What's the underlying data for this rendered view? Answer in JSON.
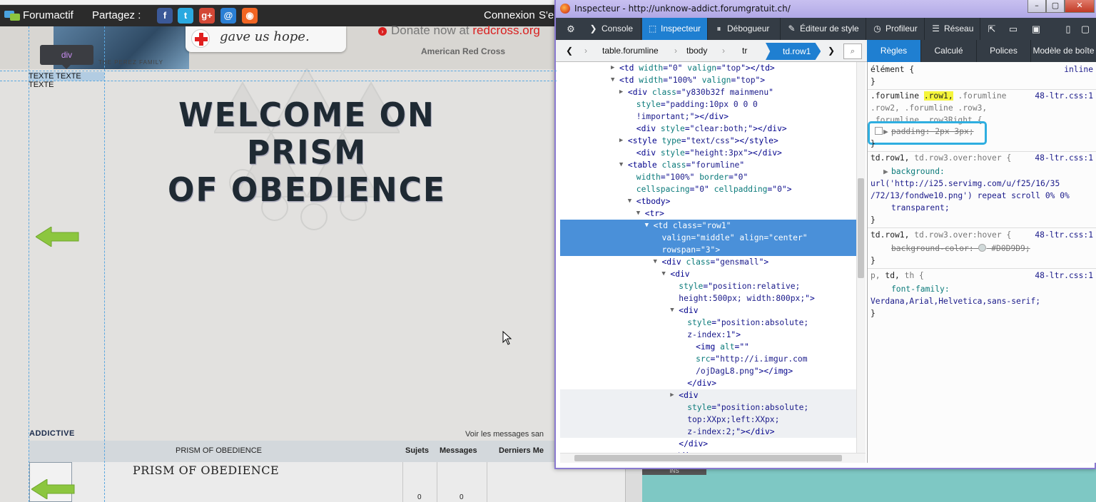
{
  "forum_bar": {
    "title": "Forumactif",
    "share_label": "Partagez :",
    "social": [
      {
        "name": "facebook-icon",
        "glyph": "f",
        "color": "#3b5998"
      },
      {
        "name": "twitter-icon",
        "glyph": "t",
        "color": "#2aa9e0"
      },
      {
        "name": "google-plus-icon",
        "glyph": "g+",
        "color": "#d34836"
      },
      {
        "name": "email-icon",
        "glyph": "@",
        "color": "#2a7fd4"
      },
      {
        "name": "rss-icon",
        "glyph": "◉",
        "color": "#f26522"
      }
    ],
    "connect": "Connexion",
    "signup_cut": "S'e"
  },
  "banner": {
    "hope_text": "gave us hope.",
    "donate_prefix": "Donate now at",
    "donate_link": "redcross.org",
    "org": "American Red Cross",
    "family": "THE PEREZ FAMILY"
  },
  "inspector_overlay": {
    "tooltip": "div",
    "highlighted_text": "TEXTE TEXTE TEXTE"
  },
  "forum": {
    "welcome_line1": "WELCOME ON PRISM",
    "welcome_line2": "OF OBEDIENCE",
    "category": "ADDICTIVE",
    "view_messages": "Voir les messages san",
    "col_forum": "PRISM OF OBEDIENCE",
    "col_topics": "Sujets",
    "col_messages": "Messages",
    "col_last": "Derniers Me",
    "row_title": "PRISM OF OBEDIENCE",
    "row_topics": "0",
    "row_messages": "0"
  },
  "inspector": {
    "window_title": "Inspecteur - http://unknow-addict.forumgratuit.ch/",
    "toolbar": {
      "console": "Console",
      "inspector": "Inspecteur",
      "debugger": "Débogueur",
      "style_editor": "Éditeur de style",
      "profiler": "Profileur",
      "network": "Réseau"
    },
    "breadcrumbs": [
      "table.forumline",
      "tbody",
      "tr"
    ],
    "breadcrumb_active": "td.row1",
    "side_tabs": [
      "Règles",
      "Calculé",
      "Polices",
      "Modèle de boîte"
    ],
    "markup": [
      {
        "indent": 11,
        "tw": "▶",
        "parts": [
          [
            "tg",
            "<td "
          ],
          [
            "at",
            "width"
          ],
          [
            "tg",
            "=\""
          ],
          [
            "av",
            "0"
          ],
          [
            "tg",
            "\" "
          ],
          [
            "at",
            "valign"
          ],
          [
            "tg",
            "=\""
          ],
          [
            "av",
            "top"
          ],
          [
            "tg",
            "\"></td>"
          ]
        ]
      },
      {
        "indent": 11,
        "tw": "▼",
        "parts": [
          [
            "tg",
            "<td "
          ],
          [
            "at",
            "width"
          ],
          [
            "tg",
            "=\""
          ],
          [
            "av",
            "100%"
          ],
          [
            "tg",
            "\" "
          ],
          [
            "at",
            "valign"
          ],
          [
            "tg",
            "=\""
          ],
          [
            "av",
            "top"
          ],
          [
            "tg",
            "\">"
          ]
        ]
      },
      {
        "indent": 12,
        "tw": "▶",
        "parts": [
          [
            "tg",
            "<div "
          ],
          [
            "at",
            "class"
          ],
          [
            "tg",
            "=\""
          ],
          [
            "av",
            "y830b32f mainmenu"
          ],
          [
            "tg",
            "\""
          ]
        ]
      },
      {
        "indent": 13,
        "tw": "",
        "parts": [
          [
            "at",
            "style"
          ],
          [
            "tg",
            "=\""
          ],
          [
            "av",
            "padding:10px 0 0 0"
          ]
        ]
      },
      {
        "indent": 13,
        "tw": "",
        "parts": [
          [
            "av",
            "!important;"
          ],
          [
            "tg",
            "\"></div>"
          ]
        ]
      },
      {
        "indent": 13,
        "tw": "",
        "parts": [
          [
            "tg",
            "<div "
          ],
          [
            "at",
            "style"
          ],
          [
            "tg",
            "=\""
          ],
          [
            "av",
            "clear:both;"
          ],
          [
            "tg",
            "\"></div>"
          ]
        ]
      },
      {
        "indent": 12,
        "tw": "▶",
        "parts": [
          [
            "tg",
            "<style "
          ],
          [
            "at",
            "type"
          ],
          [
            "tg",
            "=\""
          ],
          [
            "av",
            "text/css"
          ],
          [
            "tg",
            "\"></style>"
          ]
        ]
      },
      {
        "indent": 13,
        "tw": "",
        "parts": [
          [
            "tg",
            "<div "
          ],
          [
            "at",
            "style"
          ],
          [
            "tg",
            "=\""
          ],
          [
            "av",
            "height:3px"
          ],
          [
            "tg",
            "\"></div>"
          ]
        ]
      },
      {
        "indent": 12,
        "tw": "▼",
        "parts": [
          [
            "tg",
            "<table "
          ],
          [
            "at",
            "class"
          ],
          [
            "tg",
            "=\""
          ],
          [
            "av",
            "forumline"
          ],
          [
            "tg",
            "\""
          ]
        ]
      },
      {
        "indent": 13,
        "tw": "",
        "parts": [
          [
            "at",
            "width"
          ],
          [
            "tg",
            "=\""
          ],
          [
            "av",
            "100%"
          ],
          [
            "tg",
            "\" "
          ],
          [
            "at",
            "border"
          ],
          [
            "tg",
            "=\""
          ],
          [
            "av",
            "0"
          ],
          [
            "tg",
            "\""
          ]
        ]
      },
      {
        "indent": 13,
        "tw": "",
        "parts": [
          [
            "at",
            "cellspacing"
          ],
          [
            "tg",
            "=\""
          ],
          [
            "av",
            "0"
          ],
          [
            "tg",
            "\" "
          ],
          [
            "at",
            "cellpadding"
          ],
          [
            "tg",
            "=\""
          ],
          [
            "av",
            "0"
          ],
          [
            "tg",
            "\">"
          ]
        ]
      },
      {
        "indent": 13,
        "tw": "▼",
        "parts": [
          [
            "tg",
            "<tbody>"
          ]
        ]
      },
      {
        "indent": 14,
        "tw": "▼",
        "parts": [
          [
            "tg",
            "<tr>"
          ]
        ]
      },
      {
        "indent": 15,
        "tw": "▼",
        "sel": true,
        "parts": [
          [
            "tg",
            "<td "
          ],
          [
            "at",
            "class"
          ],
          [
            "tg",
            "=\""
          ],
          [
            "av",
            "row1"
          ],
          [
            "tg",
            "\""
          ]
        ]
      },
      {
        "indent": 16,
        "tw": "",
        "sel": true,
        "parts": [
          [
            "at",
            "valign"
          ],
          [
            "tg",
            "=\""
          ],
          [
            "av",
            "middle"
          ],
          [
            "tg",
            "\" "
          ],
          [
            "at",
            "align"
          ],
          [
            "tg",
            "=\""
          ],
          [
            "av",
            "center"
          ],
          [
            "tg",
            "\""
          ]
        ]
      },
      {
        "indent": 16,
        "tw": "",
        "sel": true,
        "parts": [
          [
            "at",
            "rowspan"
          ],
          [
            "tg",
            "=\""
          ],
          [
            "av",
            "3"
          ],
          [
            "tg",
            "\">"
          ]
        ]
      },
      {
        "indent": 16,
        "tw": "▼",
        "parts": [
          [
            "tg",
            "<div "
          ],
          [
            "at",
            "class"
          ],
          [
            "tg",
            "=\""
          ],
          [
            "av",
            "gensmall"
          ],
          [
            "tg",
            "\">"
          ]
        ]
      },
      {
        "indent": 17,
        "tw": "▼",
        "parts": [
          [
            "tg",
            "<div"
          ]
        ]
      },
      {
        "indent": 18,
        "tw": "",
        "parts": [
          [
            "at",
            "style"
          ],
          [
            "tg",
            "=\""
          ],
          [
            "av",
            "position:relative;"
          ]
        ]
      },
      {
        "indent": 18,
        "tw": "",
        "parts": [
          [
            "av",
            "height:500px; width:800px;"
          ],
          [
            "tg",
            "\">"
          ]
        ]
      },
      {
        "indent": 18,
        "tw": "▼",
        "parts": [
          [
            "tg",
            "<div"
          ]
        ]
      },
      {
        "indent": 19,
        "tw": "",
        "parts": [
          [
            "at",
            "style"
          ],
          [
            "tg",
            "=\""
          ],
          [
            "av",
            "position:absolute;"
          ]
        ]
      },
      {
        "indent": 19,
        "tw": "",
        "parts": [
          [
            "av",
            "z-index:1"
          ],
          [
            "tg",
            "\">"
          ]
        ]
      },
      {
        "indent": 20,
        "tw": "",
        "parts": [
          [
            "tg",
            "<img "
          ],
          [
            "at",
            "alt"
          ],
          [
            "tg",
            "=\"\""
          ]
        ]
      },
      {
        "indent": 20,
        "tw": "",
        "parts": [
          [
            "at",
            "src"
          ],
          [
            "tg",
            "=\""
          ],
          [
            "av",
            "http://i.imgur.com"
          ]
        ]
      },
      {
        "indent": 20,
        "tw": "",
        "parts": [
          [
            "av",
            "/ojDagL8.png"
          ],
          [
            "tg",
            "\"></img>"
          ]
        ]
      },
      {
        "indent": 19,
        "tw": "",
        "parts": [
          [
            "tg",
            "</div>"
          ]
        ]
      },
      {
        "indent": 18,
        "tw": "▶",
        "hov": true,
        "parts": [
          [
            "tg",
            "<div"
          ]
        ]
      },
      {
        "indent": 19,
        "tw": "",
        "hov": true,
        "parts": [
          [
            "at",
            "style"
          ],
          [
            "tg",
            "=\""
          ],
          [
            "av",
            "position:absolute;"
          ]
        ]
      },
      {
        "indent": 19,
        "tw": "",
        "hov": true,
        "parts": [
          [
            "av",
            "top:XXpx;left:XXpx;"
          ]
        ]
      },
      {
        "indent": 19,
        "tw": "",
        "hov": true,
        "parts": [
          [
            "av",
            "z-index:2;"
          ],
          [
            "tg",
            "\"></div>"
          ]
        ]
      },
      {
        "indent": 18,
        "tw": "",
        "parts": [
          [
            "tg",
            "</div>"
          ]
        ]
      },
      {
        "indent": 17,
        "tw": "",
        "parts": [
          [
            "tg",
            "</div>"
          ]
        ]
      }
    ],
    "rules": {
      "element_selector": "élément {",
      "element_source": "inline",
      "close": "}",
      "r1_sel_a": ".forumline",
      "r1_sel_hl": ".row1,",
      "r1_sel_b": ".forumline",
      "r1_sel_c": ".row2, .forumline .row3,",
      "r1_sel_d": ".forumline .row3Right {",
      "r1_source": "48-ltr.css:1",
      "r1_prop": "padding: 2px 3px;",
      "r2_sel": "td.row1,",
      "r2_sel_grey": "td.row3.over:hover {",
      "r2_source": "48-ltr.css:1",
      "r2_prop": "background:",
      "r2_val1": "url('http://i25.servimg.com/u/f25/16/35",
      "r2_val2": "/72/13/fondwe10.png') repeat scroll 0% 0%",
      "r2_val3": "transparent;",
      "r3_sel": "td.row1,",
      "r3_sel_grey": "td.row3.over:hover {",
      "r3_source": "48-ltr.css:1",
      "r3_prop": "background-color:",
      "r3_val": "#D0D9D9;",
      "r4_sel": "p,",
      "r4_sel_td": "td,",
      "r4_sel_th": "th {",
      "r4_source": "48-ltr.css:1",
      "r4_prop": "font-family:",
      "r4_val": "Verdana,Arial,Helvetica,sans-serif;"
    }
  },
  "background_tag": "INS"
}
